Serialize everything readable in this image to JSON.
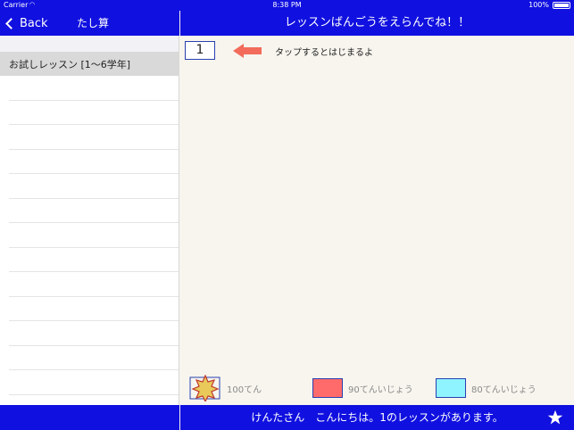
{
  "status_bar": {
    "carrier": "Carrier",
    "time": "8:38 PM",
    "battery": "100%"
  },
  "sidebar": {
    "back_label": "Back",
    "title": "たし算",
    "items": [
      {
        "label": "お試しレッスン [1〜6学年]"
      }
    ]
  },
  "main": {
    "header_title": "レッスンばんごうをえらんでね！！",
    "lesson_number": "1",
    "hint": "タップするとはじまるよ"
  },
  "legend": [
    {
      "label": "100てん",
      "color": "#e8c95a"
    },
    {
      "label": "90てんいじょう",
      "color": "#ff6b6b"
    },
    {
      "label": "80てんいじょう",
      "color": "#8ff4ff"
    }
  ],
  "footer": {
    "message": "けんたさん　こんにちは。1のレッスンがあります。"
  },
  "colors": {
    "accent": "#1010e0",
    "arrow": "#f26b5b"
  }
}
